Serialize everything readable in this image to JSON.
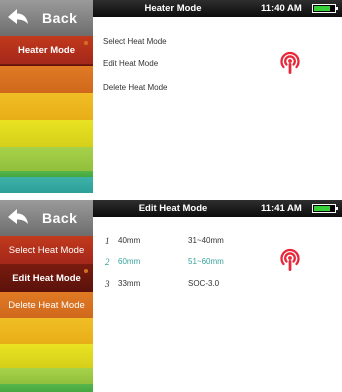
{
  "back_label": "Back",
  "battery_level": 0.8,
  "screen1": {
    "title": "Heater Mode",
    "time": "11:40 AM",
    "menu": [
      {
        "label": "Heater Mode",
        "active": true
      }
    ],
    "options": [
      "Select Heat Mode",
      "Edit Heat Mode",
      "Delete Heat Mode"
    ]
  },
  "screen2": {
    "title": "Edit Heat Mode",
    "time": "11:41 AM",
    "menu": [
      {
        "label": "Select Heat Mode",
        "active": false
      },
      {
        "label": "Edit Heat Mode",
        "active": true
      },
      {
        "label": "Delete Heat Mode",
        "active": false
      }
    ],
    "selected_index": 1,
    "modes": [
      {
        "index": "1",
        "name": "40mm",
        "range": "31~40mm"
      },
      {
        "index": "2",
        "name": "60mm",
        "range": "51~60mm"
      },
      {
        "index": "3",
        "name": "33mm",
        "range": "SOC-3.0"
      }
    ]
  },
  "colors": {
    "accent_teal": "#37a49b",
    "signal_red": "#e8283a",
    "battery_green": "#37d03a"
  }
}
